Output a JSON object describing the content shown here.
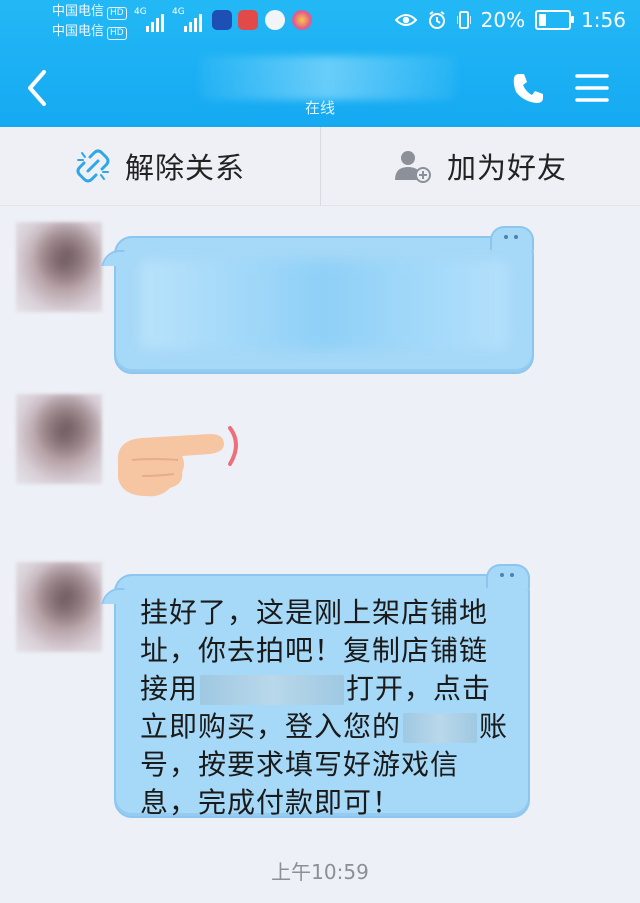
{
  "status_bar": {
    "carrier_1": "中国电信",
    "carrier_2": "中国电信",
    "hd_label": "HD",
    "network_label": "4G",
    "battery": "20%",
    "battery_level": 0.2,
    "time": "1:56"
  },
  "header": {
    "contact_status": "在线"
  },
  "actions": {
    "unlink_label": "解除关系",
    "add_friend_label": "加为好友"
  },
  "chat": {
    "message_3": {
      "parts": [
        "挂好了，这是刚上架店铺地址，你去拍吧！复制店铺链接用",
        "打开，点击立即购买，登入您的",
        "账号，按要求填写好游戏信息，完成付款即可！"
      ]
    },
    "timestamp": "上午10:59"
  },
  "colors": {
    "header_blue": "#15a9f2",
    "bubble_fill": "#a6d8f7",
    "bubble_border": "#8cc6ee",
    "icon_blue": "#2ea7e8"
  }
}
